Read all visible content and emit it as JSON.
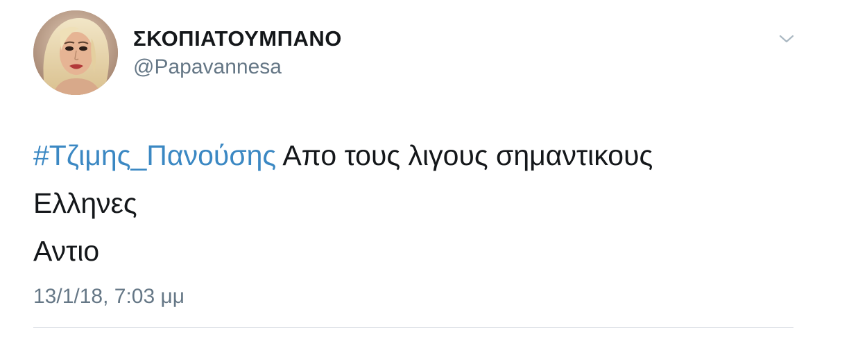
{
  "tweet": {
    "author": {
      "display_name": "ΣΚΟΠΙΑΤΟΥΜΠΑΝΟ",
      "handle": "@Papavannesa"
    },
    "body": {
      "hashtag": "#Τζιμης_Πανούσης",
      "line1_rest": " Απο τους λιγους σημαντικους",
      "line2": "Ελληνες",
      "line3": "Αντιο"
    },
    "timestamp": "13/1/18, 7:03 μμ",
    "menu_icon": "chevron-down-icon",
    "colors": {
      "hashtag": "#3b88c3",
      "secondary_text": "#657786",
      "primary_text": "#14171a"
    }
  }
}
